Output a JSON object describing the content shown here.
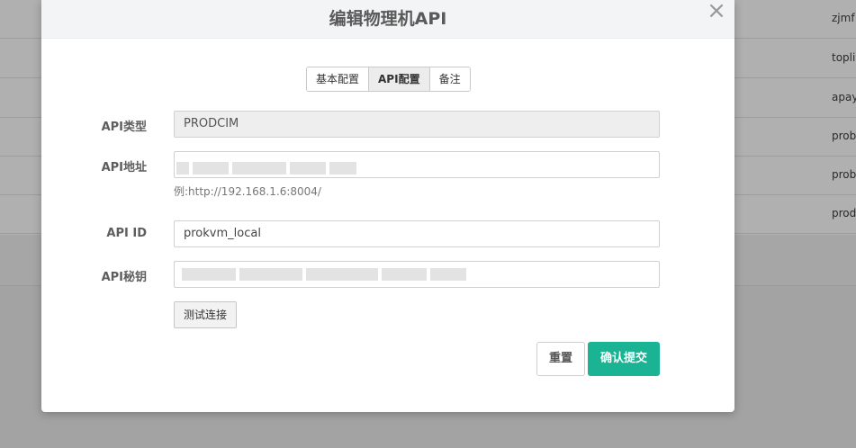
{
  "modal": {
    "title": "编辑物理机API",
    "close_glyph": "×"
  },
  "tabs": [
    {
      "label": "基本配置",
      "active": false
    },
    {
      "label": "API配置",
      "active": true
    },
    {
      "label": "备注",
      "active": false
    }
  ],
  "form": {
    "api_type": {
      "label": "API类型",
      "value": "PRODCIM"
    },
    "api_address": {
      "label": "API地址",
      "value": "",
      "hint": "例:http://192.168.1.6:8004/"
    },
    "api_id": {
      "label": "API ID",
      "value": "prokvm_local"
    },
    "api_secret": {
      "label": "API秘钥",
      "value": ""
    }
  },
  "buttons": {
    "test": "测试连接",
    "reset": "重置",
    "submit": "确认提交"
  },
  "background": {
    "rows": [
      "zjmf",
      "topli",
      "apay",
      "prob",
      "prob",
      "prod"
    ]
  },
  "colors": {
    "primary": "#1ab394",
    "overlay": "#a9a9a9"
  }
}
